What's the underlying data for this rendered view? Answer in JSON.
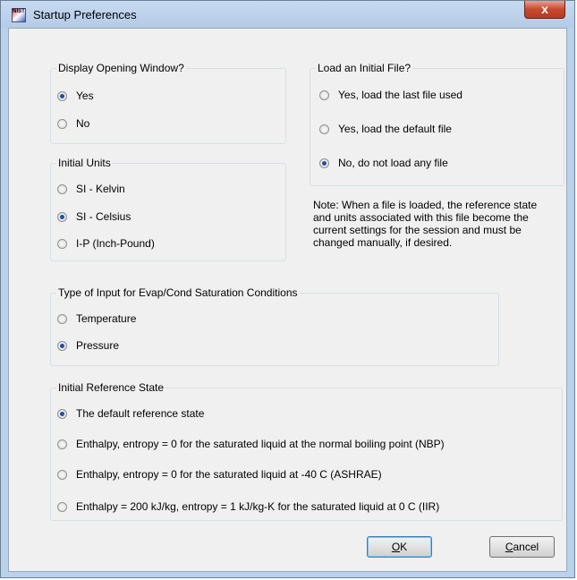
{
  "window": {
    "title": "Startup Preferences",
    "icon_text": "NIST",
    "close_label": "x"
  },
  "display_opening": {
    "legend": "Display Opening Window?",
    "options": [
      "Yes",
      "No"
    ],
    "selected": 0
  },
  "load_file": {
    "legend": "Load an Initial File?",
    "options": [
      "Yes, load the last file used",
      "Yes, load the default file",
      "No, do not load any file"
    ],
    "selected": 2
  },
  "initial_units": {
    "legend": "Initial Units",
    "options": [
      "SI - Kelvin",
      "SI - Celsius",
      "I-P (Inch-Pound)"
    ],
    "selected": 1
  },
  "note": {
    "text": "Note: When a file is loaded, the reference state and units associated with this file become the current settings for the session and must be changed manually, if desired."
  },
  "input_type": {
    "legend": "Type of Input for Evap/Cond Saturation Conditions",
    "options": [
      "Temperature",
      "Pressure"
    ],
    "selected": 1
  },
  "reference_state": {
    "legend": "Initial Reference State",
    "options": [
      "The default reference state",
      "Enthalpy, entropy = 0 for the saturated liquid at the normal boiling point (NBP)",
      "Enthalpy, entropy = 0 for the saturated liquid at -40 C (ASHRAE)",
      "Enthalpy = 200 kJ/kg, entropy = 1 kJ/kg-K for the saturated liquid at 0 C (IIR)"
    ],
    "selected": 0
  },
  "buttons": {
    "ok_mnemonic": "O",
    "ok_rest": "K",
    "cancel_mnemonic": "C",
    "cancel_rest": "ancel"
  },
  "colors": {
    "radio_selected": "#20509e",
    "dialog_bg": "#f0f0f0",
    "titlebar": "#b9d1ea",
    "close_button": "#c8482f"
  }
}
